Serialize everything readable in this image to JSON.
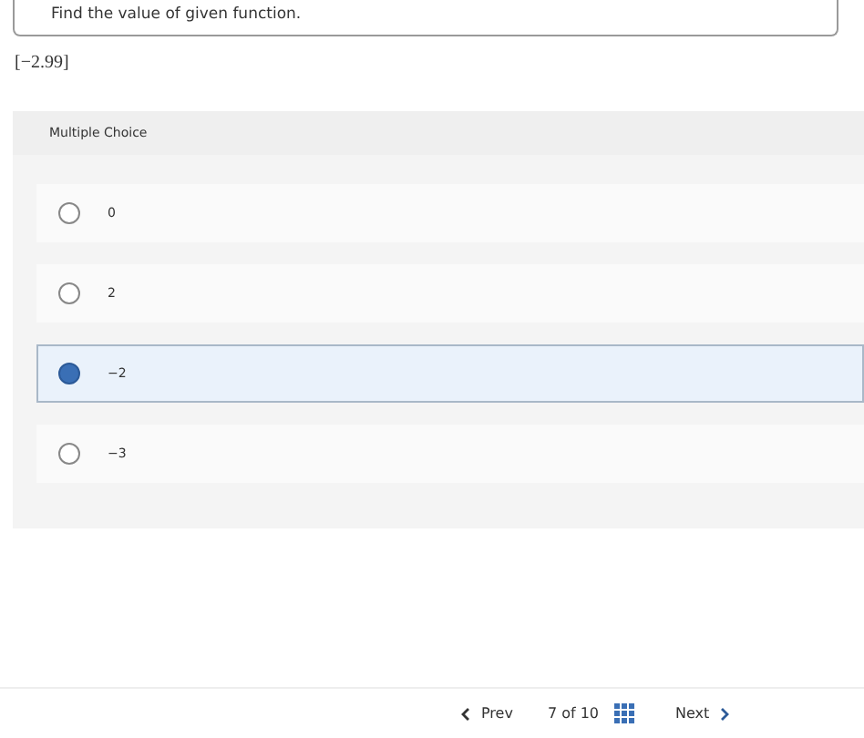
{
  "prompt": {
    "text": "Find the value of given function."
  },
  "expression": "[−2.99]",
  "question": {
    "type_label": "Multiple Choice",
    "options": [
      {
        "label": "0",
        "selected": false
      },
      {
        "label": "2",
        "selected": false
      },
      {
        "label": "−2",
        "selected": true
      },
      {
        "label": "−3",
        "selected": false
      }
    ]
  },
  "pager": {
    "prev": "Prev",
    "position": "7 of 10",
    "next": "Next"
  }
}
